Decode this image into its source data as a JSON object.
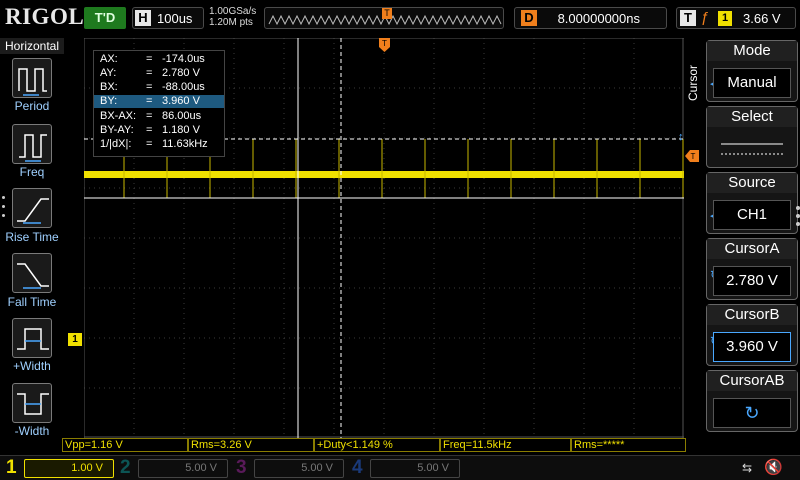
{
  "brand": {
    "logo": "RIGOL"
  },
  "status": {
    "run_state": "T'D"
  },
  "horizontal": {
    "label": "H",
    "timebase": "100us",
    "sample_rate": "1.00GSa/s",
    "memory_depth": "1.20M pts"
  },
  "delay": {
    "label": "D",
    "value": "8.00000000ns"
  },
  "trigger": {
    "label": "T",
    "edge_icon": "rising-edge-icon",
    "channel": "1",
    "level": "3.66 V"
  },
  "left_menu": {
    "title": "Horizontal",
    "items": [
      {
        "label": "Period",
        "icon": "period-icon"
      },
      {
        "label": "Freq",
        "icon": "freq-icon"
      },
      {
        "label": "Rise Time",
        "icon": "rise-time-icon"
      },
      {
        "label": "Fall Time",
        "icon": "fall-time-icon"
      },
      {
        "label": "+Width",
        "icon": "positive-width-icon"
      },
      {
        "label": "-Width",
        "icon": "negative-width-icon"
      }
    ]
  },
  "cursor_readout": [
    {
      "key": "AX:",
      "value": "-174.0us"
    },
    {
      "key": "AY:",
      "value": "2.780 V"
    },
    {
      "key": "BX:",
      "value": "-88.00us"
    },
    {
      "key": "BY:",
      "value": "3.960 V"
    },
    {
      "key": "BX-AX:",
      "value": "86.00us"
    },
    {
      "key": "BY-AY:",
      "value": "1.180 V"
    },
    {
      "key": "1/|dX|:",
      "value": "11.63kHz"
    }
  ],
  "readout_eq": "=",
  "channel_marker": "1",
  "trigger_marker": "T",
  "right_menu": {
    "title": "Cursor",
    "items": [
      {
        "title": "Mode",
        "value": "Manual"
      },
      {
        "title": "Select",
        "value": ""
      },
      {
        "title": "Source",
        "value": "CH1"
      },
      {
        "title": "CursorA",
        "value": "2.780 V"
      },
      {
        "title": "CursorB",
        "value": "3.960 V"
      },
      {
        "title": "CursorAB",
        "value": ""
      }
    ]
  },
  "measurements": [
    "Vpp=1.16 V",
    "Rms=3.26 V",
    "+Duty<1.149 %",
    "Freq=11.5kHz",
    "Rms=*****"
  ],
  "channels": [
    {
      "num": "1",
      "coupling": "",
      "scale": "1.00 V",
      "color": "#f0e000"
    },
    {
      "num": "2",
      "coupling": "",
      "scale": "5.00 V",
      "color": "#17e6e6"
    },
    {
      "num": "3",
      "coupling": "",
      "scale": "5.00 V",
      "color": "#e020e0"
    },
    {
      "num": "4",
      "coupling": "",
      "scale": "5.00 V",
      "color": "#2a7bff"
    }
  ],
  "colors": {
    "ch1": "#f0e000",
    "trigger": "#f07f1c",
    "accent": "#4aa8ff",
    "run": "#1e7a1e"
  }
}
